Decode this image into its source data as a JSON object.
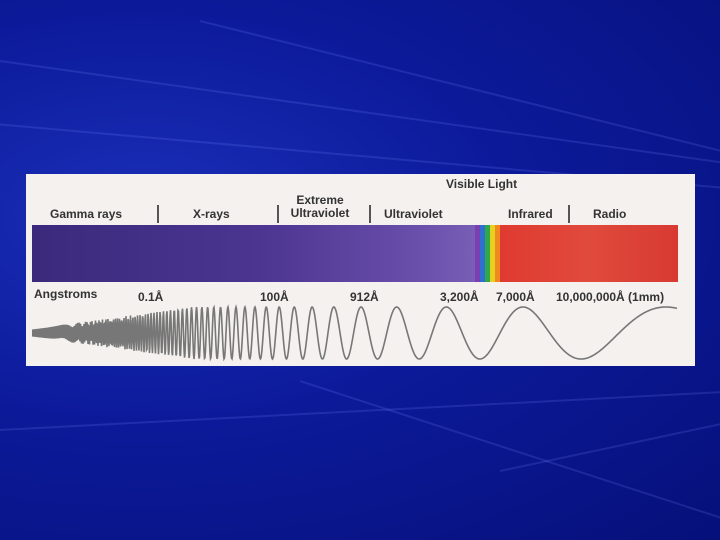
{
  "spectrum": {
    "regions": [
      {
        "id": "gamma",
        "label": "Gamma rays"
      },
      {
        "id": "xray",
        "label": "X-rays"
      },
      {
        "id": "euv",
        "label": "Extreme Ultraviolet"
      },
      {
        "id": "uv",
        "label": "Ultraviolet"
      },
      {
        "id": "visible",
        "label": "Visible Light"
      },
      {
        "id": "ir",
        "label": "Infrared"
      },
      {
        "id": "radio",
        "label": "Radio"
      }
    ],
    "scale_label": "Angstroms",
    "wavelength_ticks": [
      "0.1Å",
      "100Å",
      "912Å",
      "3,200Å",
      "7,000Å",
      "10,000,000Å (1mm)"
    ],
    "visible_colors": [
      "#7a3fb0",
      "#2f6fd0",
      "#2fa84a",
      "#e8d020",
      "#f08a20"
    ]
  }
}
